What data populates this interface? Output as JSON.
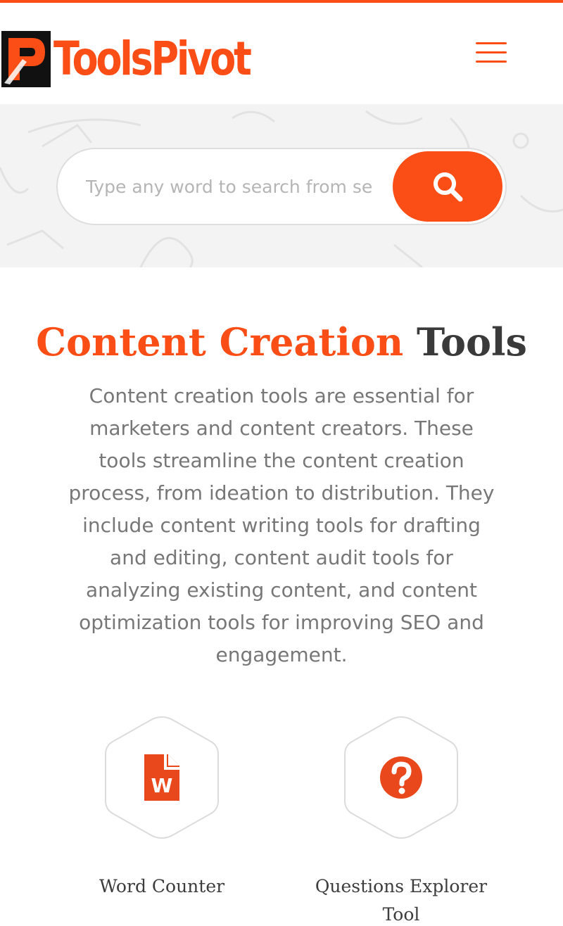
{
  "brand": {
    "name": "ToolsPivot",
    "accent_color": "#fa4e16"
  },
  "header": {
    "menu_icon": "hamburger-menu-icon"
  },
  "search": {
    "placeholder": "Type any word to search from se",
    "button_icon": "search-icon"
  },
  "section": {
    "title_accent": "Content Creation",
    "title_rest": "Tools",
    "description": "Content creation tools are essential for marketers and content creators. These tools streamline the content creation process, from ideation to distribution. They include content writing tools for drafting and editing, content audit tools for analyzing existing content, and content optimization tools for improving SEO and engagement."
  },
  "tools": [
    {
      "label": "Word Counter",
      "icon": "word-document-icon"
    },
    {
      "label": "Questions Explorer Tool",
      "icon": "question-circle-icon"
    }
  ]
}
